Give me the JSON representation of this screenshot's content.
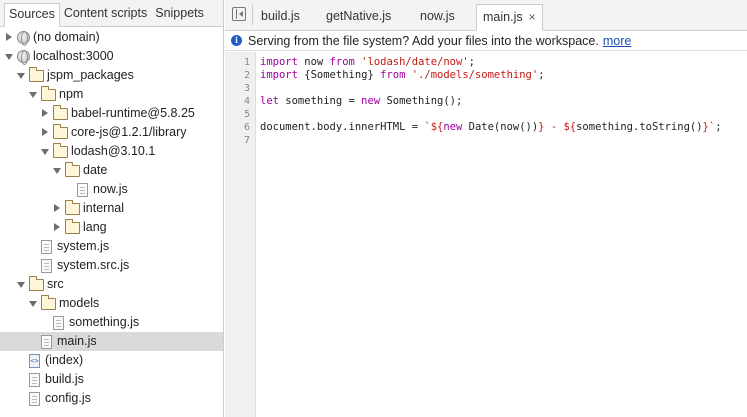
{
  "navigator": {
    "tabs": [
      {
        "label": "Sources",
        "active": true
      },
      {
        "label": "Content scripts",
        "active": false
      },
      {
        "label": "Snippets",
        "active": false
      }
    ],
    "tree": [
      {
        "label": "(no domain)",
        "icon": "globe-icon",
        "arrow": "collapsed",
        "depth": 0
      },
      {
        "label": "localhost:3000",
        "icon": "globe-icon",
        "arrow": "expanded",
        "depth": 0
      },
      {
        "label": "jspm_packages",
        "icon": "folder-icon",
        "arrow": "expanded",
        "depth": 1
      },
      {
        "label": "npm",
        "icon": "folder-icon",
        "arrow": "expanded",
        "depth": 2
      },
      {
        "label": "babel-runtime@5.8.25",
        "icon": "folder-icon",
        "arrow": "collapsed",
        "depth": 3
      },
      {
        "label": "core-js@1.2.1/library",
        "icon": "folder-icon",
        "arrow": "collapsed",
        "depth": 3
      },
      {
        "label": "lodash@3.10.1",
        "icon": "folder-icon",
        "arrow": "expanded",
        "depth": 3
      },
      {
        "label": "date",
        "icon": "folder-icon",
        "arrow": "expanded",
        "depth": 4
      },
      {
        "label": "now.js",
        "icon": "file-icon",
        "arrow": "none",
        "depth": 5
      },
      {
        "label": "internal",
        "icon": "folder-icon",
        "arrow": "collapsed",
        "depth": 4
      },
      {
        "label": "lang",
        "icon": "folder-icon",
        "arrow": "collapsed",
        "depth": 4
      },
      {
        "label": "system.js",
        "icon": "file-icon",
        "arrow": "none",
        "depth": 2
      },
      {
        "label": "system.src.js",
        "icon": "file-icon",
        "arrow": "none",
        "depth": 2
      },
      {
        "label": "src",
        "icon": "folder-icon",
        "arrow": "expanded",
        "depth": 1
      },
      {
        "label": "models",
        "icon": "folder-icon",
        "arrow": "expanded",
        "depth": 2
      },
      {
        "label": "something.js",
        "icon": "file-icon",
        "arrow": "none",
        "depth": 3
      },
      {
        "label": "main.js",
        "icon": "file-icon",
        "arrow": "none",
        "depth": 2,
        "selected": true
      },
      {
        "label": "(index)",
        "icon": "html-file-icon",
        "arrow": "none",
        "depth": 1
      },
      {
        "label": "build.js",
        "icon": "file-icon",
        "arrow": "none",
        "depth": 1
      },
      {
        "label": "config.js",
        "icon": "file-icon",
        "arrow": "none",
        "depth": 1
      }
    ]
  },
  "editor": {
    "tabs": [
      {
        "label": "build.js",
        "active": false
      },
      {
        "label": "getNative.js",
        "active": false
      },
      {
        "label": "now.js",
        "active": false
      },
      {
        "label": "main.js",
        "active": true
      }
    ],
    "close_glyph": "×",
    "infobar": {
      "icon_glyph": "i",
      "message": "Serving from the file system? Add your files into the workspace.",
      "link": "more"
    },
    "lines": [
      [
        {
          "t": "import",
          "c": "kw"
        },
        {
          "t": " now "
        },
        {
          "t": "from",
          "c": "kw"
        },
        {
          "t": " "
        },
        {
          "t": "'lodash/date/now'",
          "c": "str"
        },
        {
          "t": ";"
        }
      ],
      [
        {
          "t": "import",
          "c": "kw"
        },
        {
          "t": " {Something} "
        },
        {
          "t": "from",
          "c": "kw"
        },
        {
          "t": " "
        },
        {
          "t": "'./models/something'",
          "c": "str"
        },
        {
          "t": ";"
        }
      ],
      [],
      [
        {
          "t": "let",
          "c": "kw"
        },
        {
          "t": " something = "
        },
        {
          "t": "new",
          "c": "kw"
        },
        {
          "t": " Something();"
        }
      ],
      [],
      [
        {
          "t": "document.body.innerHTML = "
        },
        {
          "t": "`${",
          "c": "tpl"
        },
        {
          "t": "new",
          "c": "kw"
        },
        {
          "t": " Date(now())"
        },
        {
          "t": "} - ${",
          "c": "tpl"
        },
        {
          "t": "something.toString()"
        },
        {
          "t": "}`",
          "c": "tpl"
        },
        {
          "t": ";"
        }
      ],
      []
    ]
  }
}
